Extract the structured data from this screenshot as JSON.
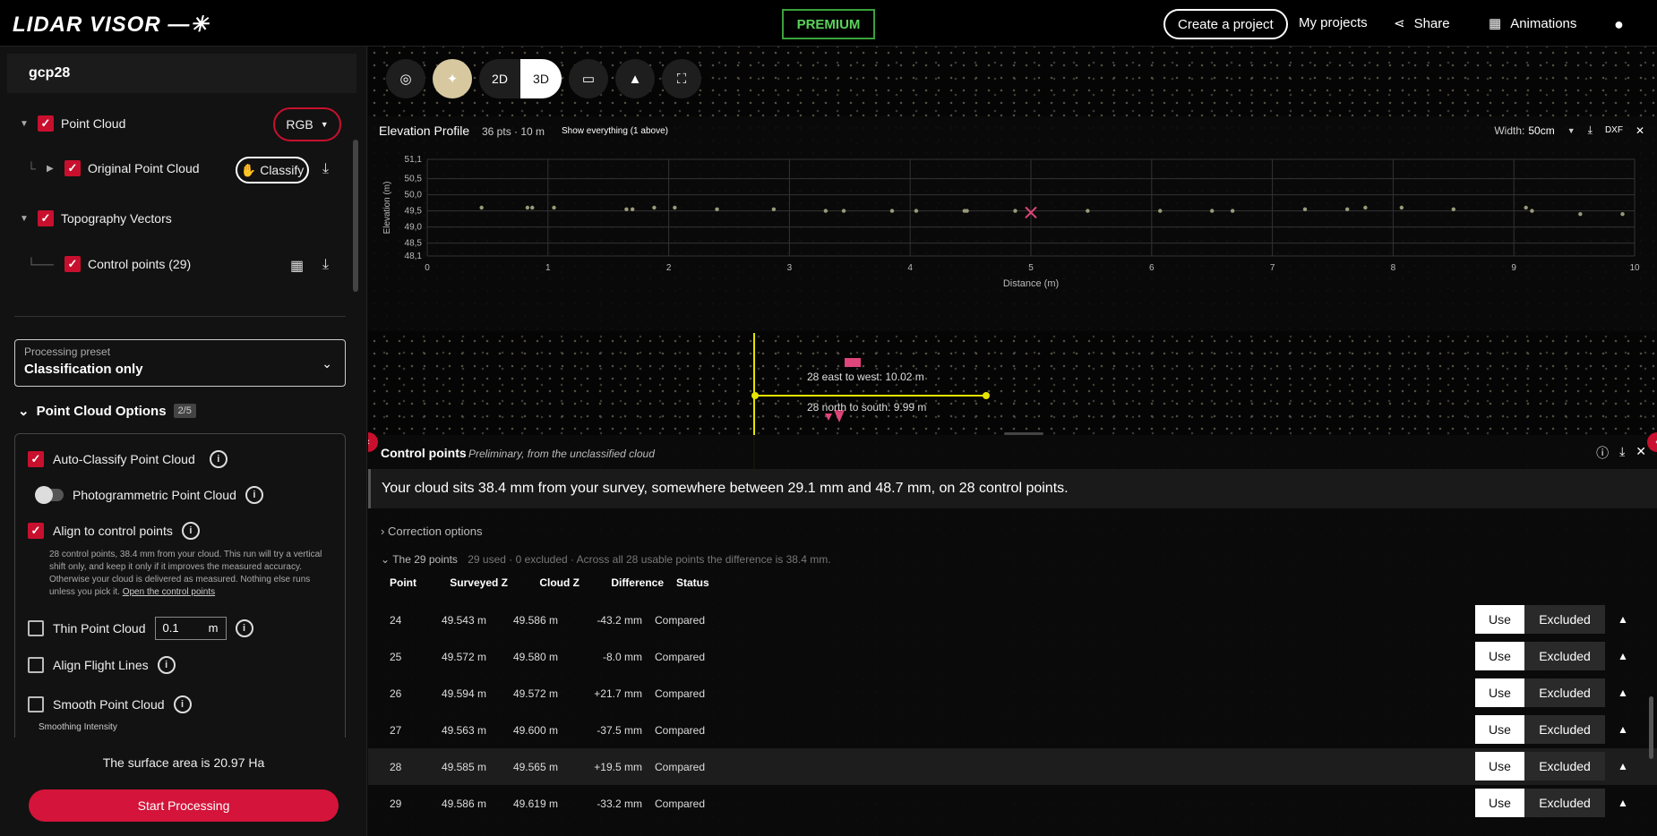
{
  "app": {
    "logo": "LIDAR VISOR —✳",
    "premium": "PREMIUM"
  },
  "nav": {
    "create": "Create a project",
    "my_projects": "My projects",
    "share": "Share",
    "animations": "Animations"
  },
  "sidebar": {
    "project": "gcp28",
    "point_cloud": "Point Cloud",
    "rgb": "RGB",
    "original": "Original Point Cloud",
    "classify": "Classify",
    "topo": "Topography Vectors",
    "control_points": "Control points (29)",
    "preset_label": "Processing preset",
    "preset_value": "Classification only",
    "options_title": "Point Cloud Options",
    "options_count": "2/5",
    "auto_classify": "Auto-Classify Point Cloud",
    "photogrammetric": "Photogrammetric Point Cloud",
    "align_cp": "Align to control points",
    "align_note": "28 control points, 38.4 mm from your cloud. This run will try a vertical shift only, and keep it only if it improves the measured accuracy. Otherwise your cloud is delivered as measured. Nothing else runs unless you pick it.",
    "align_link": "Open the control points",
    "thin": "Thin Point Cloud",
    "thin_value": "0.1",
    "thin_unit": "m",
    "flight_lines": "Align Flight Lines",
    "smooth": "Smooth Point Cloud",
    "smooth_intensity": "Smoothing Intensity",
    "surface": "The surface area is 20.97 Ha",
    "start": "Start Processing"
  },
  "toolbar": {
    "mode_2d": "2D",
    "mode_3d": "3D"
  },
  "elevation": {
    "title": "Elevation Profile",
    "meta": "36 pts · 10 m",
    "show": "Show everything (1 above)",
    "width_label": "Width:",
    "width_value": "50cm",
    "dxf": "DXF"
  },
  "chart_data": {
    "type": "scatter",
    "xlabel": "Distance (m)",
    "ylabel": "Elevation (m)",
    "xlim": [
      0,
      10
    ],
    "ylim": [
      48.1,
      51.1
    ],
    "x_ticks": [
      "0",
      "1",
      "2",
      "3",
      "4",
      "5",
      "6",
      "7",
      "8",
      "9",
      "10"
    ],
    "y_ticks": [
      "51,1",
      "50,5",
      "50,0",
      "49,5",
      "49,0",
      "48,5",
      "48,1"
    ],
    "series": [
      {
        "points": [
          [
            0.45,
            49.6
          ],
          [
            0.83,
            49.6
          ],
          [
            0.87,
            49.6
          ],
          [
            1.05,
            49.6
          ],
          [
            1.65,
            49.55
          ],
          [
            1.7,
            49.55
          ],
          [
            1.88,
            49.6
          ],
          [
            2.05,
            49.6
          ],
          [
            2.4,
            49.55
          ],
          [
            2.87,
            49.55
          ],
          [
            3.3,
            49.5
          ],
          [
            3.45,
            49.5
          ],
          [
            3.85,
            49.5
          ],
          [
            4.05,
            49.5
          ],
          [
            4.45,
            49.5
          ],
          [
            4.47,
            49.5
          ],
          [
            4.87,
            49.5
          ],
          [
            5.47,
            49.5
          ],
          [
            6.07,
            49.5
          ],
          [
            6.5,
            49.5
          ],
          [
            6.67,
            49.5
          ],
          [
            7.27,
            49.55
          ],
          [
            7.62,
            49.55
          ],
          [
            7.77,
            49.6
          ],
          [
            8.07,
            49.6
          ],
          [
            8.5,
            49.55
          ],
          [
            9.1,
            49.6
          ],
          [
            9.15,
            49.5
          ],
          [
            9.55,
            49.4
          ],
          [
            9.9,
            49.4
          ]
        ]
      },
      {
        "marker": [
          [
            5.0,
            49.45
          ]
        ]
      }
    ]
  },
  "scene": {
    "ew": "28 east to west: 10.02 m",
    "ns": "28 north to south: 9.99 m"
  },
  "control_panel": {
    "title": "Control points",
    "subtitle": "Preliminary, from the unclassified cloud",
    "banner": "Your cloud sits 38.4 mm from your survey, somewhere between 29.1 mm and 48.7 mm, on 28 control points.",
    "correction": "Correction options",
    "points_title": "The 29 points",
    "points_sub": "29 used · 0 excluded · Across all 28 usable points the difference is 38.4 mm.",
    "headers": [
      "Point",
      "Surveyed Z",
      "Cloud Z",
      "Difference",
      "Status"
    ],
    "use": "Use",
    "excluded": "Excluded",
    "rows": [
      {
        "point": "24",
        "surveyed": "49.543 m",
        "cloud": "49.586 m",
        "diff": "-43.2 mm",
        "status": "Compared"
      },
      {
        "point": "25",
        "surveyed": "49.572 m",
        "cloud": "49.580 m",
        "diff": "-8.0 mm",
        "status": "Compared"
      },
      {
        "point": "26",
        "surveyed": "49.594 m",
        "cloud": "49.572 m",
        "diff": "+21.7 mm",
        "status": "Compared"
      },
      {
        "point": "27",
        "surveyed": "49.563 m",
        "cloud": "49.600 m",
        "diff": "-37.5 mm",
        "status": "Compared"
      },
      {
        "point": "28",
        "surveyed": "49.585 m",
        "cloud": "49.565 m",
        "diff": "+19.5 mm",
        "status": "Compared"
      },
      {
        "point": "29",
        "surveyed": "49.586 m",
        "cloud": "49.619 m",
        "diff": "-33.2 mm",
        "status": "Compared"
      }
    ]
  }
}
